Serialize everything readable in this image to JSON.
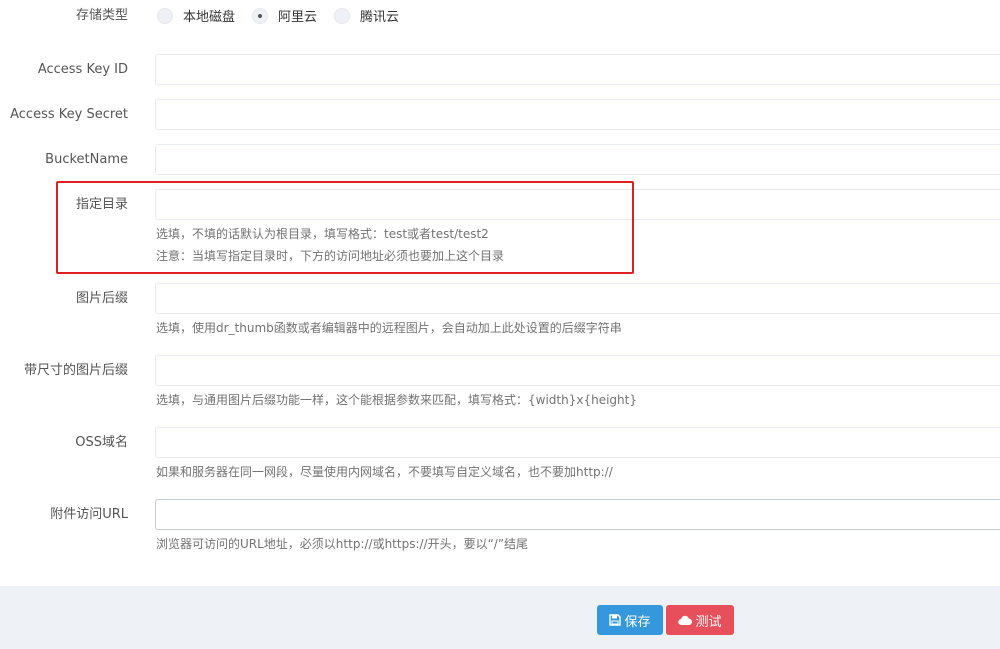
{
  "storage": {
    "label": "存储类型",
    "options": [
      {
        "label": "本地磁盘",
        "checked": false
      },
      {
        "label": "阿里云",
        "checked": true
      },
      {
        "label": "腾讯云",
        "checked": false
      }
    ]
  },
  "fields": {
    "access_key_id": {
      "label": "Access Key ID",
      "value": ""
    },
    "access_key_secret": {
      "label": "Access Key Secret",
      "value": ""
    },
    "bucket_name": {
      "label": "BucketName",
      "value": ""
    },
    "directory": {
      "label": "指定目录",
      "value": "",
      "help1": "选填，不填的话默认为根目录，填写格式：test或者test/test2",
      "help2": "注意：当填写指定目录时，下方的访问地址必须也要加上这个目录"
    },
    "image_suffix": {
      "label": "图片后缀",
      "value": "",
      "help": "选填，使用dr_thumb函数或者编辑器中的远程图片，会自动加上此处设置的后缀字符串"
    },
    "sized_image_suffix": {
      "label": "带尺寸的图片后缀",
      "value": "",
      "help": "选填，与通用图片后缀功能一样，这个能根据参数来匹配，填写格式：{width}x{height}"
    },
    "oss_domain": {
      "label": "OSS域名",
      "value": "",
      "help": "如果和服务器在同一网段，尽量使用内网域名，不要填写自定义域名，也不要加http://"
    },
    "attachment_url": {
      "label": "附件访问URL",
      "value": "",
      "help": "浏览器可访问的URL地址，必须以http://或https://开头，要以“/”结尾"
    }
  },
  "buttons": {
    "save": "保存",
    "test": "测试"
  },
  "colors": {
    "primary": "#3598dc",
    "danger": "#e7505a",
    "highlight": "#e02020",
    "footer_bg": "#eef1f5"
  }
}
